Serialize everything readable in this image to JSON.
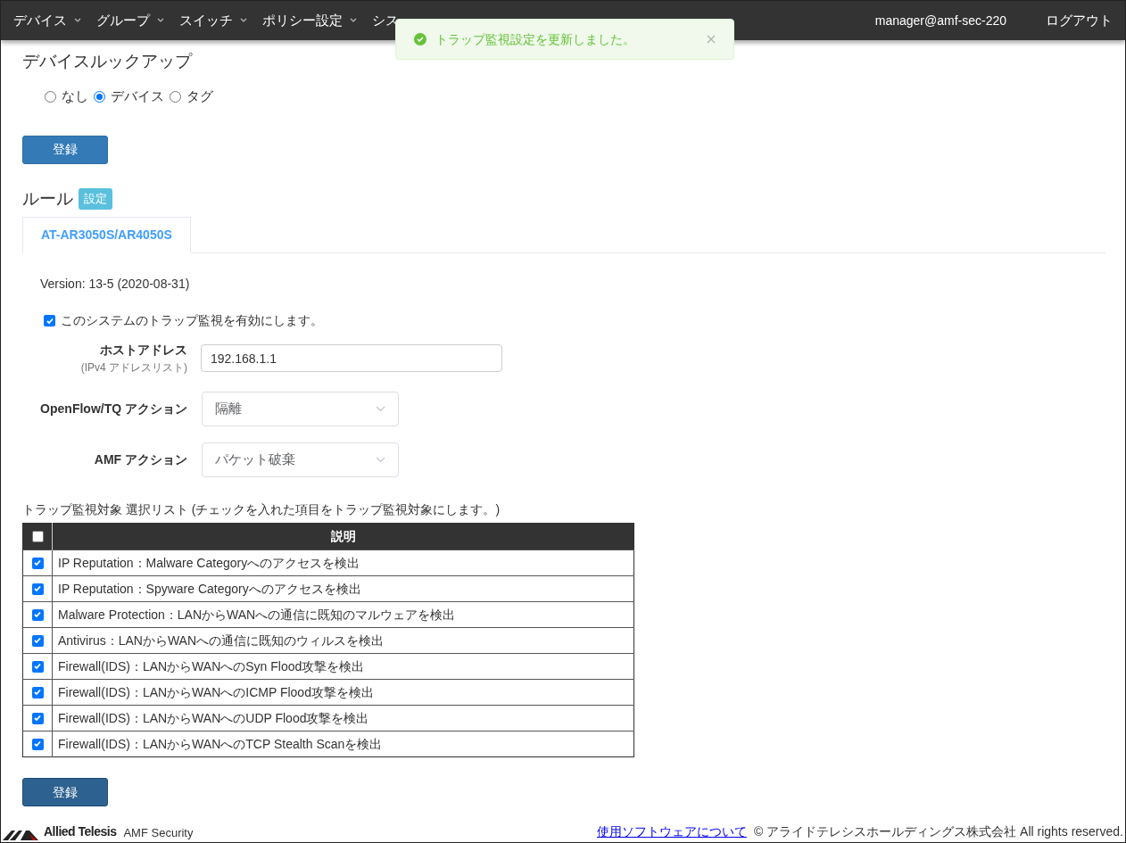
{
  "nav": {
    "items": [
      {
        "label": "デバイス",
        "dropdown": true
      },
      {
        "label": "グループ",
        "dropdown": true
      },
      {
        "label": "スイッチ",
        "dropdown": true
      },
      {
        "label": "ポリシー設定",
        "dropdown": true
      },
      {
        "label": "シス",
        "dropdown": false
      }
    ],
    "user": "manager@amf-sec-220",
    "logout": "ログアウト"
  },
  "toast": {
    "message": "トラップ監視設定を更新しました。"
  },
  "lookup": {
    "title": "デバイスルックアップ",
    "options": [
      {
        "label": "なし",
        "selected": false
      },
      {
        "label": "デバイス",
        "selected": true
      },
      {
        "label": "タグ",
        "selected": false
      }
    ],
    "submit": "登録"
  },
  "rules": {
    "title": "ルール",
    "badge": "設定",
    "tabs": [
      {
        "label": "AT-AR3050S/AR4050S",
        "selected": true
      }
    ],
    "version": "Version: 13-5 (2020-08-31)",
    "enable": {
      "label": "このシステムのトラップ監視を有効にします。",
      "checked": true
    },
    "host": {
      "label": "ホストアドレス",
      "hint": "(IPv4 アドレスリスト)",
      "value": "192.168.1.1"
    },
    "selects": [
      {
        "label": "OpenFlow/TQ アクション",
        "value": "隔離"
      },
      {
        "label": "AMF アクション",
        "value": "パケット破棄"
      }
    ],
    "list_title": "トラップ監視対象 選択リスト (チェックを入れた項目をトラップ監視対象にします。)",
    "table": {
      "header_checked": false,
      "column": "説明",
      "rows": [
        {
          "text": "IP Reputation：Malware Categoryへのアクセスを検出",
          "checked": true
        },
        {
          "text": "IP Reputation：Spyware Categoryへのアクセスを検出",
          "checked": true
        },
        {
          "text": "Malware Protection：LANからWANへの通信に既知のマルウェアを検出",
          "checked": true
        },
        {
          "text": "Antivirus：LANからWANへの通信に既知のウィルスを検出",
          "checked": true
        },
        {
          "text": "Firewall(IDS)：LANからWANへのSyn Flood攻撃を検出",
          "checked": true
        },
        {
          "text": "Firewall(IDS)：LANからWANへのICMP Flood攻撃を検出",
          "checked": true
        },
        {
          "text": "Firewall(IDS)：LANからWANへのUDP Flood攻撃を検出",
          "checked": true
        },
        {
          "text": "Firewall(IDS)：LANからWANへのTCP Stealth Scanを検出",
          "checked": true
        }
      ]
    },
    "submit": "登録"
  },
  "footer": {
    "brand": "Allied Telesis",
    "product": "AMF Security",
    "link": "使用ソフトウェアについて",
    "copyright": "© アライドテレシスホールディングス株式会社 All rights reserved."
  }
}
